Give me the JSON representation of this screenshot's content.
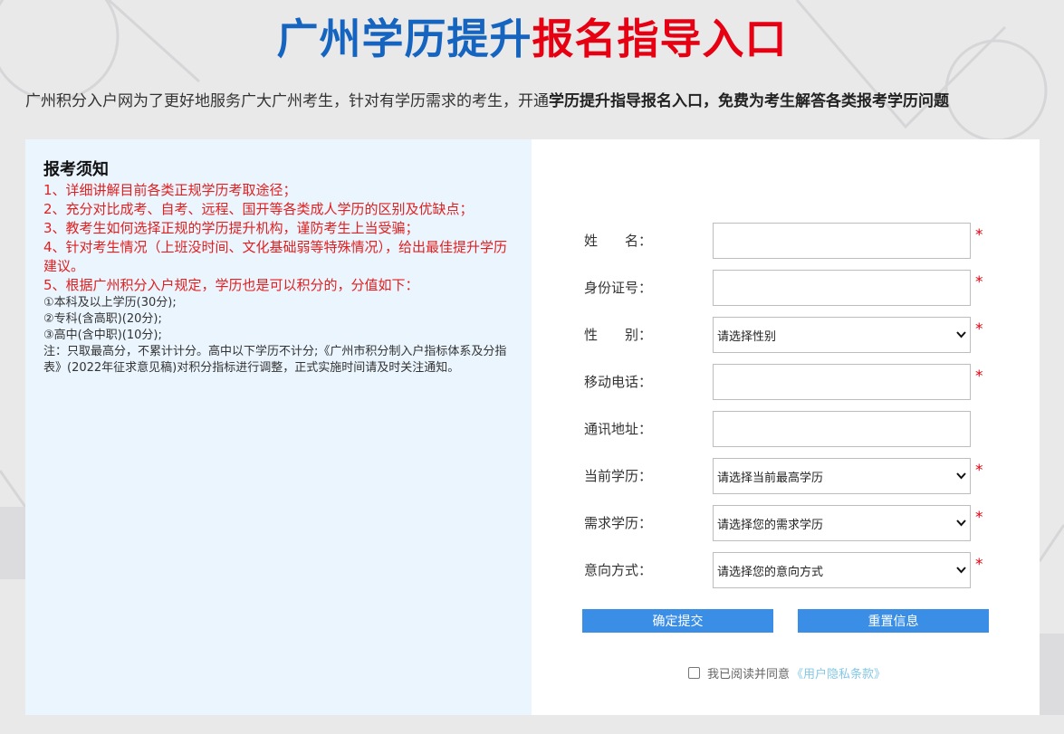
{
  "header": {
    "title_part1": "广州学历提升",
    "title_part2": "报名指导入口",
    "subtitle_normal": "广州积分入户网为了更好地服务广大广州考生，针对有学历需求的考生，开通",
    "subtitle_bold": "学历提升指导报名入口，免费为考生解答各类报考学历问题"
  },
  "notice": {
    "title": "报考须知",
    "red_items": [
      "1、详细讲解目前各类正规学历考取途径；",
      "2、充分对比成考、自考、远程、国开等各类成人学历的区别及优缺点；",
      "3、教考生如何选择正规的学历提升机构，谨防考生上当受骗；",
      "4、针对考生情况（上班没时间、文化基础弱等特殊情况），给出最佳提升学历建议。",
      "5、根据广州积分入户规定，学历也是可以积分的，分值如下："
    ],
    "small_items": [
      "①本科及以上学历(30分);",
      "②专科(含高职)(20分);",
      "③高中(含中职)(10分);",
      "注：只取最高分，不累计计分。高中以下学历不计分;《广州市积分制入户指标体系及分指表》(2022年征求意见稿)对积分指标进行调整，正式实施时间请及时关注通知。"
    ]
  },
  "form": {
    "name_label": "姓　　名：",
    "id_label": "身份证号：",
    "gender_label": "性　　别：",
    "gender_placeholder": "请选择性别",
    "phone_label": "移动电话：",
    "address_label": "通讯地址：",
    "current_edu_label": "当前学历：",
    "current_edu_placeholder": "请选择当前最高学历",
    "target_edu_label": "需求学历：",
    "target_edu_placeholder": "请选择您的需求学历",
    "mode_label": "意向方式：",
    "mode_placeholder": "请选择您的意向方式",
    "required_mark": "*",
    "submit_label": "确定提交",
    "reset_label": "重置信息",
    "agree_text": "我已阅读并同意",
    "agree_link": "《用户隐私条款》"
  }
}
